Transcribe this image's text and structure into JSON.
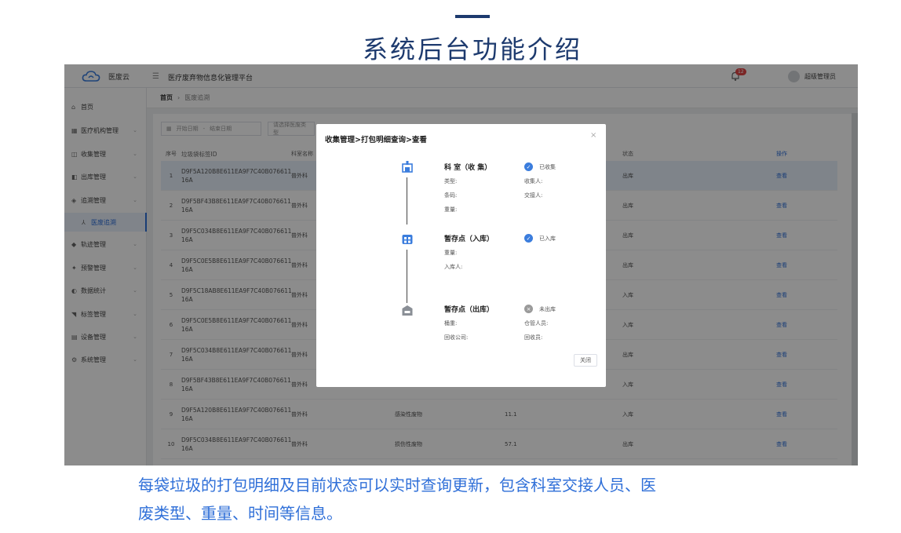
{
  "slide": {
    "title": "系统后台功能介绍",
    "caption_lines": [
      "每袋垃圾的打包明细及目前状态可以实时查询更新，包含科室交接人员、医",
      "废类型、重量、时间等信息。"
    ]
  },
  "app": {
    "brand": "医废云",
    "platform_title": "医疗废弃物信息化管理平台",
    "notification_count": "12",
    "user_name": "超级管理员",
    "sidebar": [
      {
        "icon": "home-icon",
        "glyph": "⌂",
        "label": "首页"
      },
      {
        "icon": "hospital-icon",
        "glyph": "▦",
        "label": "医疗机构管理"
      },
      {
        "icon": "collect-icon",
        "glyph": "◫",
        "label": "收集管理"
      },
      {
        "icon": "outbound-icon",
        "glyph": "◧",
        "label": "出库管理"
      },
      {
        "icon": "trace-icon",
        "glyph": "◈",
        "label": "追溯管理"
      },
      {
        "icon": "trace-sub-icon",
        "glyph": "⅄",
        "label": "医废追溯"
      },
      {
        "icon": "track-icon",
        "glyph": "◆",
        "label": "轨迹管理"
      },
      {
        "icon": "alert-icon",
        "glyph": "✦",
        "label": "预警管理"
      },
      {
        "icon": "stats-icon",
        "glyph": "◐",
        "label": "数据统计"
      },
      {
        "icon": "tag-icon",
        "glyph": "◥",
        "label": "标签管理"
      },
      {
        "icon": "device-icon",
        "glyph": "▤",
        "label": "设备管理"
      },
      {
        "icon": "system-icon",
        "glyph": "⚙",
        "label": "系统管理"
      }
    ],
    "breadcrumb": {
      "home": "首页",
      "current": "医废追溯"
    },
    "filter": {
      "start_date": "开始日期",
      "separator": "-",
      "end_date": "结束日期",
      "search_placeholder": "请选择医废类型"
    },
    "table": {
      "headers": [
        "序号",
        "垃圾袋标签ID",
        "科室名称",
        "",
        "",
        "状态",
        "操作"
      ],
      "rows": [
        {
          "no": "1",
          "id": "D9F5A120B8E611EA9F7C40B076611 16A",
          "dept": "普外科",
          "type": "",
          "weight": "",
          "status": "出库",
          "op": "查看"
        },
        {
          "no": "2",
          "id": "D9F5BF43B8E611EA9F7C40B076611 16A",
          "dept": "普外科",
          "type": "",
          "weight": "",
          "status": "出库",
          "op": "查看"
        },
        {
          "no": "3",
          "id": "D9F5C034B8E611EA9F7C40B076611 16A",
          "dept": "普外科",
          "type": "",
          "weight": "",
          "status": "出库",
          "op": "查看"
        },
        {
          "no": "4",
          "id": "D9F5C0E5B8E611EA9F7C40B076611 16A",
          "dept": "普外科",
          "type": "",
          "weight": "",
          "status": "出库",
          "op": "查看"
        },
        {
          "no": "5",
          "id": "D9F5C18AB8E611EA9F7C40B076611 16A",
          "dept": "普外科",
          "type": "",
          "weight": "",
          "status": "入库",
          "op": "查看"
        },
        {
          "no": "6",
          "id": "D9F5C0E5B8E611EA9F7C40B076611 16A",
          "dept": "普外科",
          "type": "",
          "weight": "",
          "status": "入库",
          "op": "查看"
        },
        {
          "no": "7",
          "id": "D9F5C034B8E611EA9F7C40B076611 16A",
          "dept": "普外科",
          "type": "",
          "weight": "",
          "status": "出库",
          "op": "查看"
        },
        {
          "no": "8",
          "id": "D9F5BF43B8E611EA9F7C40B076611 16A",
          "dept": "普外科",
          "type": "",
          "weight": "",
          "status": "入库",
          "op": "查看"
        },
        {
          "no": "9",
          "id": "D9F5A120B8E611EA9F7C40B076611 16A",
          "dept": "普外科",
          "type": "感染性废物",
          "weight": "11.1",
          "status": "入库",
          "op": "查看"
        },
        {
          "no": "10",
          "id": "D9F5C034B8E611EA9F7C40B076611 16A",
          "dept": "普外科",
          "type": "损伤性废物",
          "weight": "57.1",
          "status": "出库",
          "op": "查看"
        }
      ]
    }
  },
  "modal": {
    "title": "收集管理>打包明细查询>查看",
    "close_label": "关闭",
    "steps": [
      {
        "name": "科 室（收 集）",
        "status": "已收集",
        "status_color": "#3b7ddd",
        "fields_left": [
          "类型:",
          "条码:",
          "重量:"
        ],
        "fields_right": [
          "收集人:",
          "交接人:"
        ]
      },
      {
        "name": "暂存点（入库）",
        "status": "已入库",
        "status_color": "#3b7ddd",
        "fields_left": [
          "重量:",
          "入库人:"
        ],
        "fields_right": []
      },
      {
        "name": "暂存点（出库）",
        "status": "未出库",
        "status_color": "#9a9a9a",
        "fields_left": [
          "桶重:",
          "回收公司:"
        ],
        "fields_right": [
          "仓管人员:",
          "回收员:"
        ]
      }
    ]
  }
}
